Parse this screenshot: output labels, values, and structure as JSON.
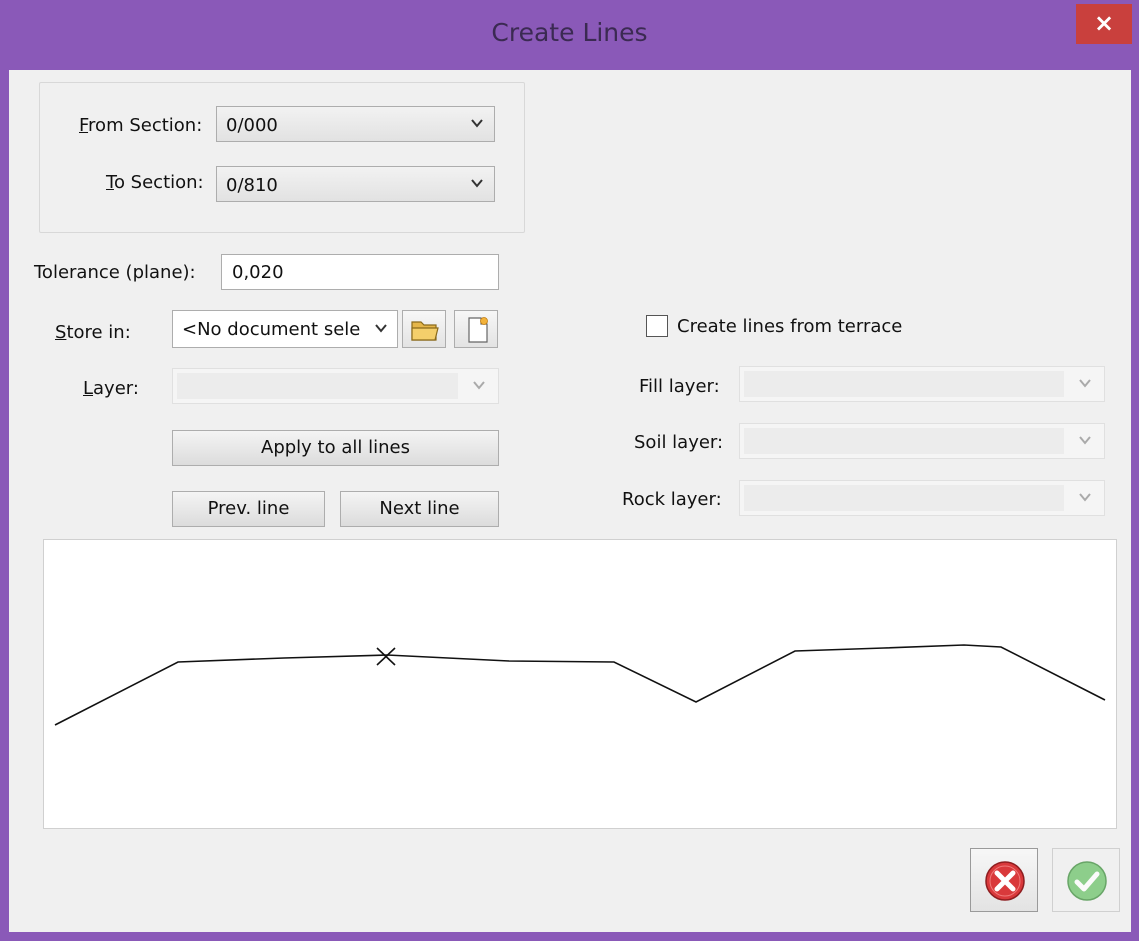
{
  "window": {
    "title": "Create Lines",
    "close_symbol": "×"
  },
  "sections": {
    "from_label_accel": "F",
    "from_label_rest": "rom Section:",
    "from_value": "0/000",
    "to_label_accel": "T",
    "to_label_rest": "o Section:",
    "to_value": "0/810"
  },
  "tolerance": {
    "label": "Tolerance (plane):",
    "value": "0,020"
  },
  "store_in": {
    "label_accel": "S",
    "label_rest": "tore in:",
    "value": "<No document sele"
  },
  "layer": {
    "label_accel": "L",
    "label_rest": "ayer:",
    "value": ""
  },
  "buttons": {
    "apply_all": "Apply to all lines",
    "prev_line": "Prev. line",
    "next_line": "Next line"
  },
  "terrace": {
    "checkbox_label": "Create lines from terrace",
    "checked": false,
    "fill_layer_label": "Fill layer:",
    "soil_layer_label": "Soil layer:",
    "rock_layer_label": "Rock layer:"
  },
  "icons": {
    "chevron": "chevron-down-icon",
    "open": "open-folder-icon",
    "new": "new-document-icon",
    "cancel": "cancel-icon",
    "ok": "ok-check-icon",
    "marker": "cross-marker-icon"
  },
  "colors": {
    "title_bar": "#8a59b8",
    "close_button": "#c9403d",
    "cancel_icon": "#d9393b",
    "ok_icon": "#6cc36a"
  }
}
